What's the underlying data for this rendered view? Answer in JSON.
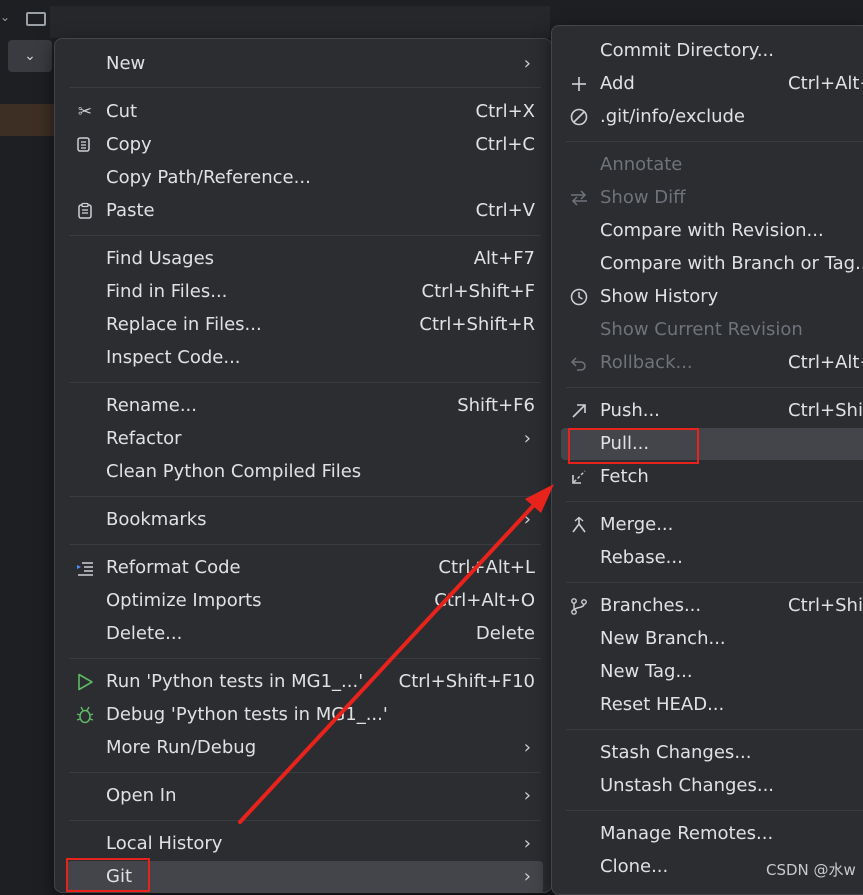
{
  "main_menu": {
    "items": [
      {
        "label": "New",
        "shortcut": "",
        "submenu": true,
        "icon": "",
        "disabled": false
      },
      {
        "label": "Cut",
        "shortcut": "Ctrl+X",
        "submenu": false,
        "icon": "scissors-icon",
        "disabled": false
      },
      {
        "label": "Copy",
        "shortcut": "Ctrl+C",
        "submenu": false,
        "icon": "copy-icon",
        "disabled": false
      },
      {
        "label": "Copy Path/Reference...",
        "shortcut": "",
        "submenu": false,
        "icon": "",
        "disabled": false
      },
      {
        "label": "Paste",
        "shortcut": "Ctrl+V",
        "submenu": false,
        "icon": "paste-icon",
        "disabled": false
      },
      {
        "label": "Find Usages",
        "shortcut": "Alt+F7",
        "submenu": false,
        "icon": "",
        "disabled": false
      },
      {
        "label": "Find in Files...",
        "shortcut": "Ctrl+Shift+F",
        "submenu": false,
        "icon": "",
        "disabled": false
      },
      {
        "label": "Replace in Files...",
        "shortcut": "Ctrl+Shift+R",
        "submenu": false,
        "icon": "",
        "disabled": false
      },
      {
        "label": "Inspect Code...",
        "shortcut": "",
        "submenu": false,
        "icon": "",
        "disabled": false
      },
      {
        "label": "Rename...",
        "shortcut": "Shift+F6",
        "submenu": false,
        "icon": "",
        "disabled": false
      },
      {
        "label": "Refactor",
        "shortcut": "",
        "submenu": true,
        "icon": "",
        "disabled": false
      },
      {
        "label": "Clean Python Compiled Files",
        "shortcut": "",
        "submenu": false,
        "icon": "",
        "disabled": false
      },
      {
        "label": "Bookmarks",
        "shortcut": "",
        "submenu": true,
        "icon": "",
        "disabled": false
      },
      {
        "label": "Reformat Code",
        "shortcut": "Ctrl+Alt+L",
        "submenu": false,
        "icon": "reformat-icon",
        "disabled": false
      },
      {
        "label": "Optimize Imports",
        "shortcut": "Ctrl+Alt+O",
        "submenu": false,
        "icon": "",
        "disabled": false
      },
      {
        "label": "Delete...",
        "shortcut": "Delete",
        "submenu": false,
        "icon": "",
        "disabled": false
      },
      {
        "label": "Run 'Python tests in MG1_...'",
        "shortcut": "Ctrl+Shift+F10",
        "submenu": false,
        "icon": "run-icon",
        "disabled": false
      },
      {
        "label": "Debug 'Python tests in MG1_...'",
        "shortcut": "",
        "submenu": false,
        "icon": "debug-icon",
        "disabled": false
      },
      {
        "label": "More Run/Debug",
        "shortcut": "",
        "submenu": true,
        "icon": "",
        "disabled": false
      },
      {
        "label": "Open In",
        "shortcut": "",
        "submenu": true,
        "icon": "",
        "disabled": false
      },
      {
        "label": "Local History",
        "shortcut": "",
        "submenu": true,
        "icon": "",
        "disabled": false
      },
      {
        "label": "Git",
        "shortcut": "",
        "submenu": true,
        "icon": "",
        "disabled": false,
        "selected": true
      }
    ]
  },
  "git_menu": {
    "items": [
      {
        "label": "Commit Directory...",
        "shortcut": "",
        "icon": "",
        "disabled": false
      },
      {
        "label": "Add",
        "shortcut": "Ctrl+Alt+A",
        "icon": "plus-icon",
        "disabled": false
      },
      {
        "label": ".git/info/exclude",
        "shortcut": "",
        "icon": "ignore-icon",
        "disabled": false
      },
      {
        "label": "Annotate",
        "shortcut": "",
        "icon": "",
        "disabled": true
      },
      {
        "label": "Show Diff",
        "shortcut": "",
        "icon": "diff-icon",
        "disabled": true
      },
      {
        "label": "Compare with Revision...",
        "shortcut": "",
        "icon": "",
        "disabled": false
      },
      {
        "label": "Compare with Branch or Tag...",
        "shortcut": "",
        "icon": "",
        "disabled": false
      },
      {
        "label": "Show History",
        "shortcut": "",
        "icon": "history-icon",
        "disabled": false
      },
      {
        "label": "Show Current Revision",
        "shortcut": "",
        "icon": "",
        "disabled": true
      },
      {
        "label": "Rollback...",
        "shortcut": "Ctrl+Alt+Z",
        "icon": "rollback-icon",
        "disabled": true
      },
      {
        "label": "Push...",
        "shortcut": "Ctrl+Shift+K",
        "icon": "push-icon",
        "disabled": false
      },
      {
        "label": "Pull...",
        "shortcut": "",
        "icon": "",
        "disabled": false,
        "selected": true
      },
      {
        "label": "Fetch",
        "shortcut": "",
        "icon": "fetch-icon",
        "disabled": false
      },
      {
        "label": "Merge...",
        "shortcut": "",
        "icon": "merge-icon",
        "disabled": false
      },
      {
        "label": "Rebase...",
        "shortcut": "",
        "icon": "",
        "disabled": false
      },
      {
        "label": "Branches...",
        "shortcut": "Ctrl+Shift+`",
        "icon": "branch-icon",
        "disabled": false
      },
      {
        "label": "New Branch...",
        "shortcut": "",
        "icon": "",
        "disabled": false
      },
      {
        "label": "New Tag...",
        "shortcut": "",
        "icon": "",
        "disabled": false
      },
      {
        "label": "Reset HEAD...",
        "shortcut": "",
        "icon": "",
        "disabled": false
      },
      {
        "label": "Stash Changes...",
        "shortcut": "",
        "icon": "",
        "disabled": false
      },
      {
        "label": "Unstash Changes...",
        "shortcut": "",
        "icon": "",
        "disabled": false
      },
      {
        "label": "Manage Remotes...",
        "shortcut": "",
        "icon": "",
        "disabled": false
      },
      {
        "label": "Clone...",
        "shortcut": "",
        "icon": "",
        "disabled": false
      }
    ]
  },
  "watermark": "CSDN @水w",
  "colors": {
    "menu_bg": "#2b2d30",
    "selected_bg": "#43454a",
    "annotation_red": "#e8231c"
  }
}
